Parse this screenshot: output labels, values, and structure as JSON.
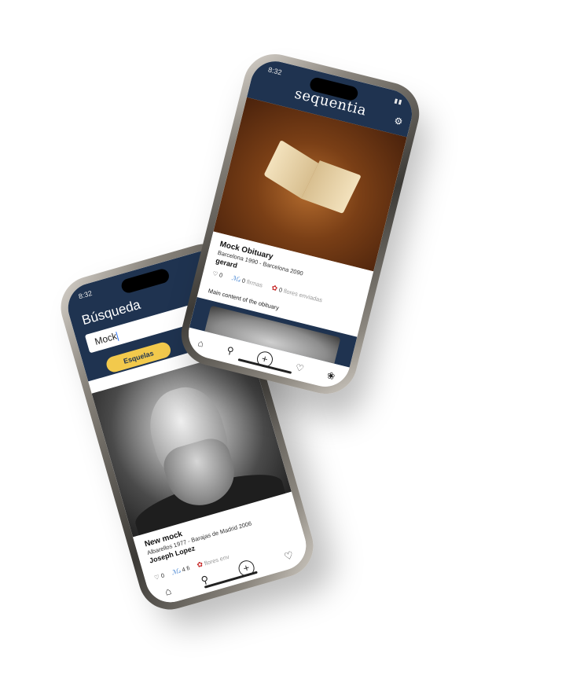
{
  "phone_search": {
    "time": "8:32",
    "title": "Búsqueda",
    "search_value": "Mock",
    "tab_label": "Esquelas",
    "result": {
      "name": "New mock",
      "dates": "Albarellos 1977 - Barajas de Madrid 2006",
      "author": "Joseph Lopez",
      "likes": "0",
      "signatures": "4 fi",
      "flowers": "flores env"
    }
  },
  "phone_obituary": {
    "time": "8:32",
    "logo": "sequentia",
    "title": "Mock Obituary",
    "dates": "Barcelona 1990 - Barcelona 2090",
    "author": "gerard",
    "likes": "0",
    "signatures_count": "0",
    "signatures_label": "firmas",
    "flowers_count": "0",
    "flowers_label": "flores enviadas",
    "content": "Main content of the obituary"
  },
  "colors": {
    "navy": "#1f3350",
    "accent_yellow": "#f2c94c"
  },
  "icons": {
    "home": "home-icon",
    "search": "search-icon",
    "add": "plus-circle-icon",
    "heart": "heart-icon",
    "flower": "flower-icon",
    "settings": "settings-icon"
  }
}
